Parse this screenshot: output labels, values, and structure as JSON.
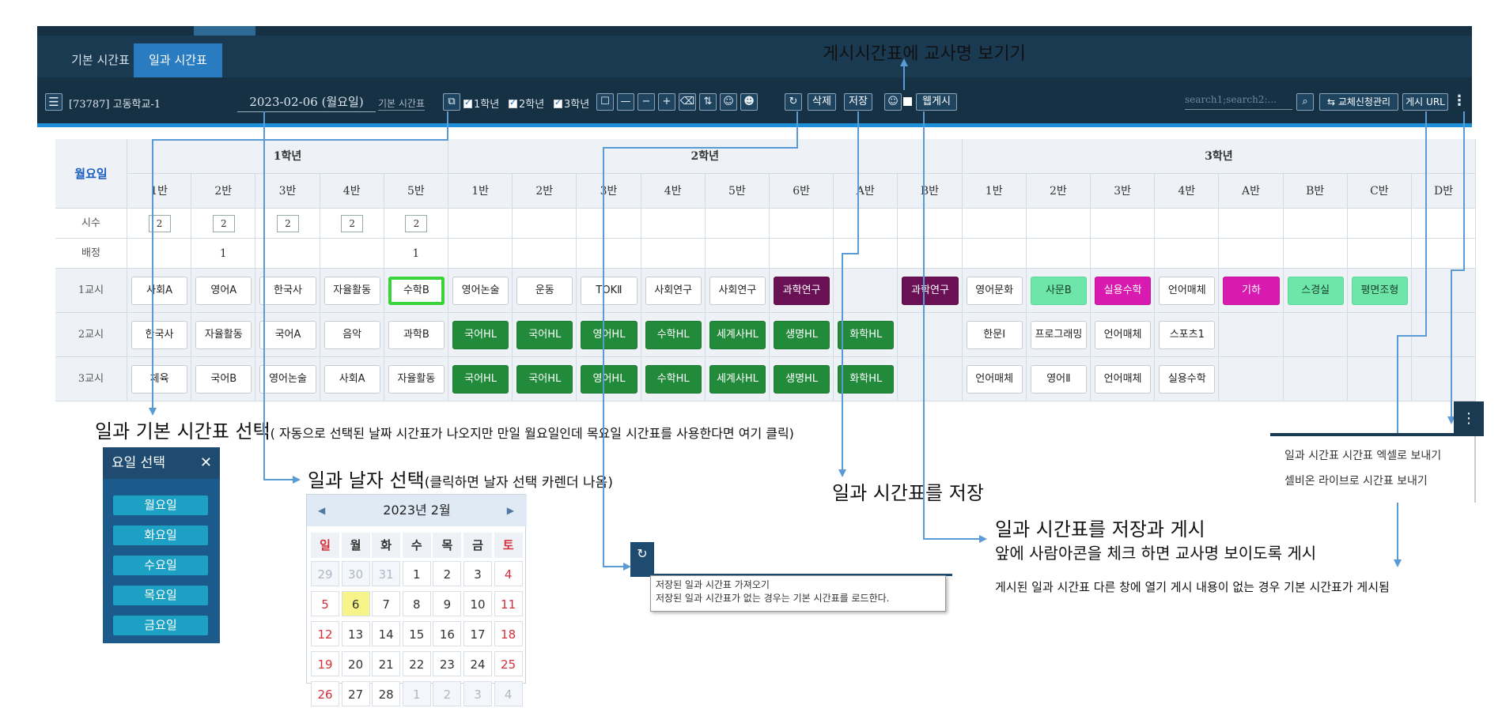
{
  "tabs": [
    "기본 시간표",
    "일과 시간표"
  ],
  "toolbar": {
    "menu_icon": "hamburger-icon",
    "school": "[73787] 고동학교-1",
    "date": "2023-02-06 (월요일)",
    "basic_link": "기본 시간표",
    "grades": [
      "1학년",
      "2학년",
      "3학년"
    ],
    "delete": "삭제",
    "save": "저장",
    "publish": "웹게시",
    "search_placeholder": "search1;search2:...",
    "swap_manage": "교체신청관리",
    "publish_url": "게시 URL"
  },
  "table": {
    "day": "월요일",
    "grades": [
      "1학년",
      "2학년",
      "3학년"
    ],
    "classes": [
      "1반",
      "2반",
      "3반",
      "4반",
      "5반",
      "1반",
      "2반",
      "3반",
      "4반",
      "5반",
      "6반",
      "A반",
      "B반",
      "1반",
      "2반",
      "3반",
      "4반",
      "A반",
      "B반",
      "C반",
      "D반"
    ],
    "row_labels": [
      "시수",
      "배정",
      "1교시",
      "2교시",
      "3교시"
    ],
    "hours": [
      "2",
      "2",
      "2",
      "2",
      "2"
    ],
    "assign": [
      "",
      "1",
      "",
      "",
      "1"
    ],
    "period1": [
      "사회A",
      "영어A",
      "한국사",
      "자율활동",
      "수학B",
      "영어논술",
      "운동",
      "TOKⅡ",
      "사회연구",
      "사회연구",
      "과학연구",
      "",
      "과학연구",
      "영어문화",
      "사문B",
      "실용수학",
      "언어매체",
      "기하",
      "스경실",
      "평면조형",
      ""
    ],
    "period2": [
      "한국사",
      "자율활동",
      "국어A",
      "음악",
      "과학B",
      "국어HL",
      "국어HL",
      "영어HL",
      "수학HL",
      "세계사HL",
      "생명HL",
      "화학HL",
      "",
      "한문Ⅰ",
      "프로그래밍",
      "언어매체",
      "스포츠1",
      "",
      "",
      "",
      ""
    ],
    "period3": [
      "체육",
      "국어B",
      "영어논술",
      "사회A",
      "자율활동",
      "국어HL",
      "국어HL",
      "영어HL",
      "수학HL",
      "세계사HL",
      "생명HL",
      "화학HL",
      "",
      "언어매체",
      "영어Ⅱ",
      "언어매체",
      "실용수학",
      "",
      "",
      "",
      ""
    ]
  },
  "annotations": {
    "show_teacher": "게시시간표에 교사명 보기기",
    "select_basic": "일과 기본 시간표 선택",
    "select_basic_note": "( 자동으로 선택된 날짜 시간표가 나오지만 만일 월요일인데 목요일 시간표를 사용한다면 여기 클릭)",
    "select_date": "일과 날자 선택",
    "select_date_note": "(클릭하면  날자 선택 카렌더 나옴)",
    "save_table": "일과 시간표를 저장",
    "save_publish": "일과 시간표를 저장과 게시",
    "save_publish_note": "앞에 사람아콘을 체크 하면 교사명 보이도록 게시",
    "published_note": "게시된 일과 시간표 다른 창에 열기 게시 내용이 없는 경우 기본 시간표가 게시됨"
  },
  "day_select": {
    "title": "요일 선택",
    "close": "✕",
    "days": [
      "월요일",
      "화요일",
      "수요일",
      "목요일",
      "금요일"
    ]
  },
  "calendar": {
    "title": "2023년 2월",
    "weekdays": [
      "일",
      "월",
      "화",
      "수",
      "목",
      "금",
      "토"
    ],
    "weeks": [
      [
        "29",
        "30",
        "31",
        "1",
        "2",
        "3",
        "4"
      ],
      [
        "5",
        "6",
        "7",
        "8",
        "9",
        "10",
        "11"
      ],
      [
        "12",
        "13",
        "14",
        "15",
        "16",
        "17",
        "18"
      ],
      [
        "19",
        "20",
        "21",
        "22",
        "23",
        "24",
        "25"
      ],
      [
        "26",
        "27",
        "28",
        "1",
        "2",
        "3",
        "4"
      ]
    ],
    "today": "6"
  },
  "reload_tooltip": {
    "line1": "저장된 일과 시간표 가져오기",
    "line2": "저장된 일과 시간표가 없는 경우는 기본 시간표를 로드한다."
  },
  "right_menu": {
    "items": [
      "일과 시간표 시간표 엑셀로 보내기",
      "셀비온 라이브로 시간표 보내기"
    ]
  },
  "colors": {
    "header_dark": "#1a3a52",
    "accent_blue": "#2a7cc0",
    "green": "#228b3b",
    "purple": "#6a1055",
    "magenta": "#d81ab0",
    "mint": "#6ee6a9"
  }
}
